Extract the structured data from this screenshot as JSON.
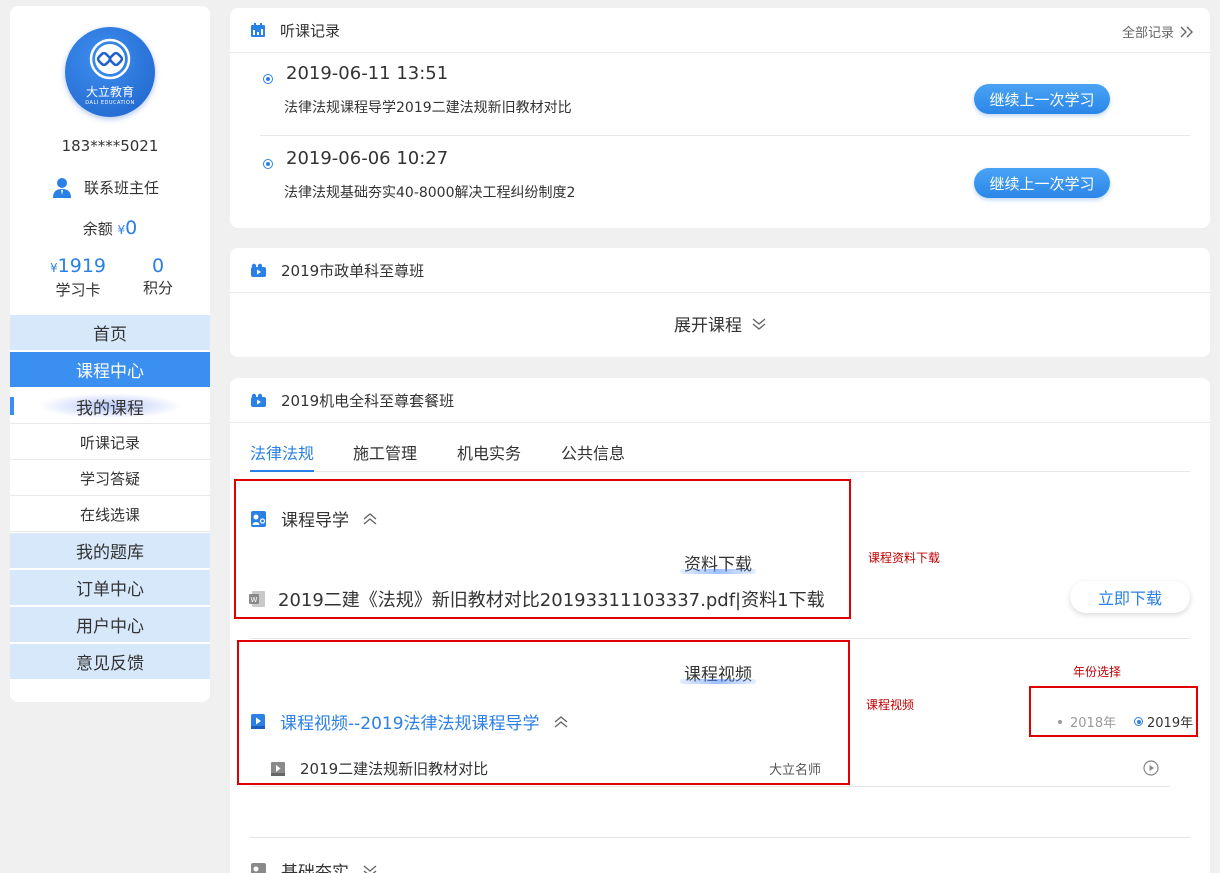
{
  "sidebar": {
    "brand": "大立教育",
    "brand_en": "DALI EDUCATION",
    "phone": "183****5021",
    "contact_label": "联系班主任",
    "balance_label": "余额",
    "balance_currency": "¥",
    "balance_value": "0",
    "card_currency": "¥",
    "card_value": "1919",
    "card_label": "学习卡",
    "points_value": "0",
    "points_label": "积分",
    "nav": {
      "home": "首页",
      "course_center": "课程中心",
      "my_courses": "我的课程",
      "history": "听课记录",
      "qa": "学习答疑",
      "online_select": "在线选课",
      "question_bank": "我的题库",
      "orders": "订单中心",
      "user_center": "用户中心",
      "feedback": "意见反馈"
    }
  },
  "history_card": {
    "title": "听课记录",
    "all_link": "全部记录",
    "records": [
      {
        "time": "2019-06-11 13:51",
        "course": "法律法规课程导学2019二建法规新旧教材对比",
        "button": "继续上一次学习"
      },
      {
        "time": "2019-06-06 10:27",
        "course": "法律法规基础夯实40-8000解决工程纠纷制度2",
        "button": "继续上一次学习"
      }
    ]
  },
  "course_card_1": {
    "title": "2019市政单科至尊班",
    "expand_label": "展开课程"
  },
  "course_card_2": {
    "title": "2019机电全科至尊套餐班",
    "tabs": [
      "法律法规",
      "施工管理",
      "机电实务",
      "公共信息"
    ],
    "guide_section": "课程导学",
    "material_label": "资料下载",
    "material_file": "2019二建《法规》新旧教材对比20193311103337.pdf|资料1下载",
    "download_button": "立即下载",
    "video_label": "课程视频",
    "video_section": "课程视频--2019法律法规课程导学",
    "video_item": "2019二建法规新旧教材对比",
    "teacher": "大立名师",
    "years": [
      "2018年",
      "2019年"
    ],
    "next_section": "基础夯实"
  },
  "annotations": {
    "material": "课程资料下载",
    "video": "课程视频",
    "year": "年份选择"
  },
  "colors": {
    "accent": "#2b80e5",
    "nav_main_bg": "#d7e8fb",
    "annotation_red": "#e00000"
  }
}
